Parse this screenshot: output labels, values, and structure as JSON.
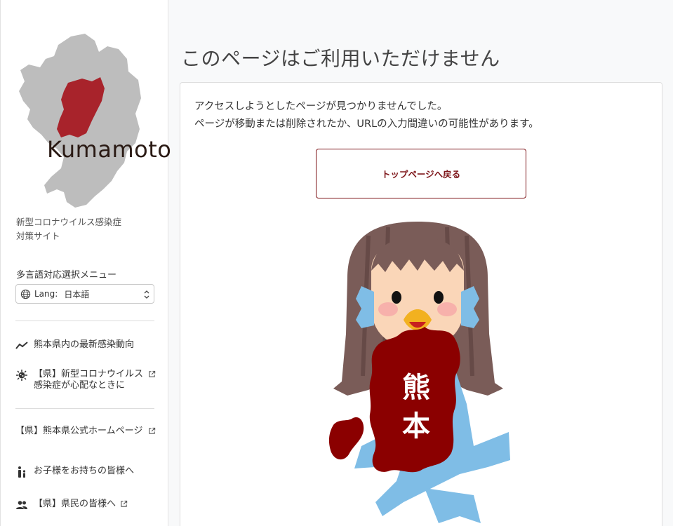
{
  "sidebar": {
    "logo_text": "Kumamoto",
    "site_title_line1": "新型コロナウイルス感染症",
    "site_title_line2": "対策サイト",
    "lang_heading": "多言語対応選択メニュー",
    "lang_label": "Lang:",
    "lang_value": "日本語",
    "nav_items": [
      {
        "label": "熊本県内の最新感染動向",
        "icon": "trend-icon",
        "external": false
      },
      {
        "label": "【県】新型コロナウイルス感染症が心配なときに",
        "icon": "virus-icon",
        "external": true
      },
      {
        "label": "【県】熊本県公式ホームページ",
        "icon": "",
        "external": true
      },
      {
        "label": "お子様をお持ちの皆様へ",
        "icon": "parent-child-icon",
        "external": false
      },
      {
        "label": "【県】県民の皆様へ",
        "icon": "people-icon",
        "external": true
      }
    ]
  },
  "main": {
    "heading": "このページはご利用いただけません",
    "message_line1": "アクセスしようとしたページが見つかりませんでした。",
    "message_line2": "ページが移動または削除されたか、URLの入力間違いの可能性があります。",
    "back_button": "トップページへ戻る",
    "illustration_text_1": "熊",
    "illustration_text_2": "本"
  },
  "colors": {
    "accent": "#7d1418",
    "map_gray": "#bdbdbd",
    "map_red": "#a8232b"
  }
}
